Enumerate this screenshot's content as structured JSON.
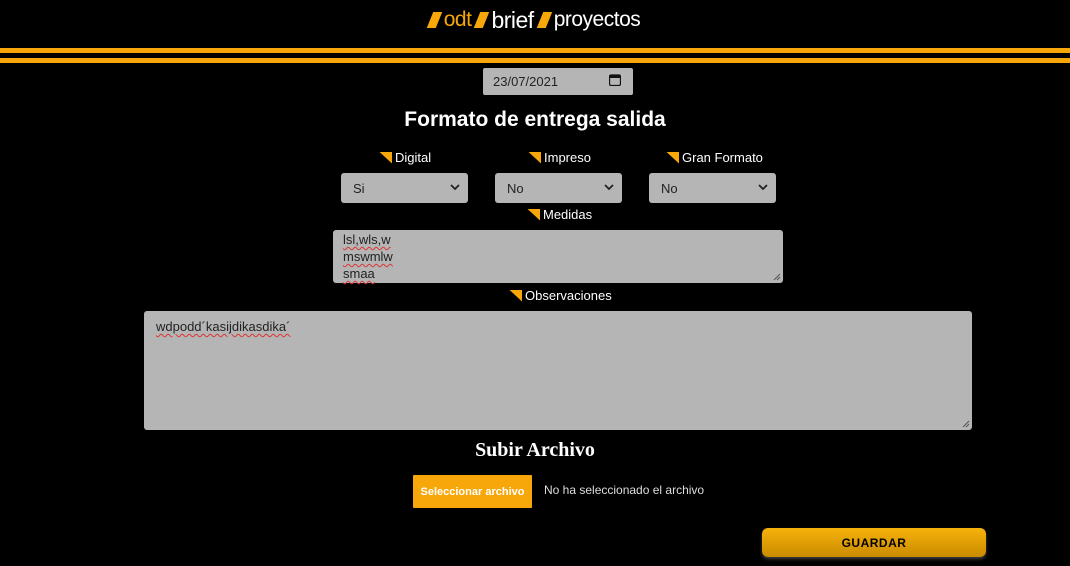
{
  "nav": {
    "items": [
      {
        "label": "odt"
      },
      {
        "label": "brief"
      },
      {
        "label": "proyectos"
      }
    ]
  },
  "date_field": {
    "value": "23/07/2021"
  },
  "formato": {
    "title": "Formato de entrega salida",
    "digital": {
      "label": "Digital",
      "value": "Si"
    },
    "impreso": {
      "label": "Impreso",
      "value": "No"
    },
    "gran_formato": {
      "label": "Gran Formato",
      "value": "No"
    }
  },
  "medidas": {
    "label": "Medidas",
    "lines": [
      "lsl,wls,w",
      "mswmlw",
      "smaa"
    ]
  },
  "observaciones": {
    "label": "Observaciones",
    "value": "wdpodd´kasijdikasdika´"
  },
  "upload": {
    "title": "Subir Archivo",
    "button_label": "Seleccionar archivo",
    "status": "No ha seleccionado el archivo"
  },
  "save_button": {
    "label": "GUARDAR"
  },
  "colors": {
    "accent": "#f7a70a",
    "field_bg": "#b5b5b5",
    "background": "#000000"
  }
}
